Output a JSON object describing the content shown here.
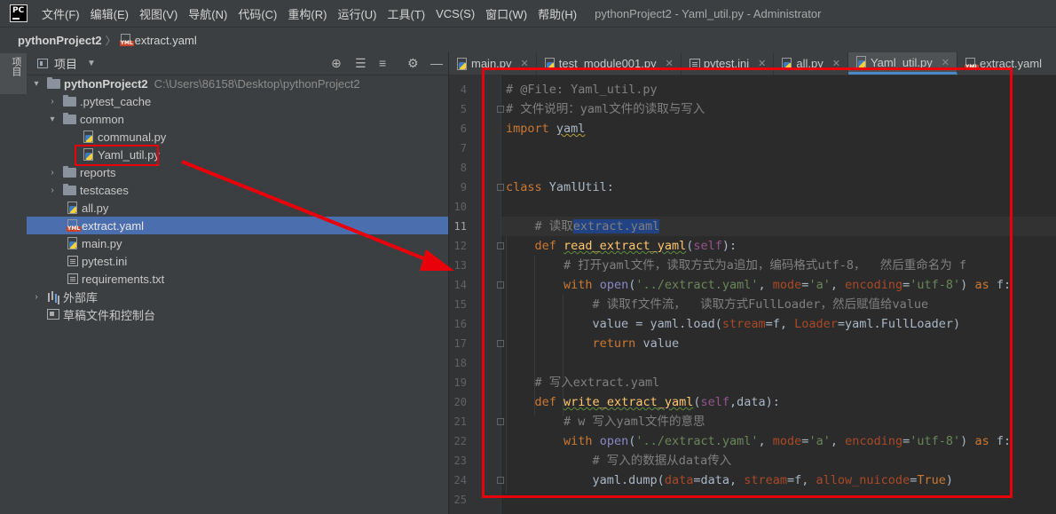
{
  "titlebar": {
    "logo": "PC",
    "menu": [
      "文件(F)",
      "编辑(E)",
      "视图(V)",
      "导航(N)",
      "代码(C)",
      "重构(R)",
      "运行(U)",
      "工具(T)",
      "VCS(S)",
      "窗口(W)",
      "帮助(H)"
    ],
    "window_title": "pythonProject2 - Yaml_util.py - Administrator"
  },
  "breadcrumb": {
    "project": "pythonProject2",
    "file": "extract.yaml"
  },
  "tool_stripe": {
    "project_label": "项目"
  },
  "project_panel": {
    "title": "项目",
    "header_icons": [
      "target-icon",
      "expand-all-icon",
      "collapse-all-icon",
      "gear-icon",
      "minimize-icon"
    ],
    "tree": [
      {
        "label": "pythonProject2",
        "path": "C:\\Users\\86158\\Desktop\\pythonProject2",
        "type": "folder",
        "expanded": true,
        "depth": 0
      },
      {
        "label": ".pytest_cache",
        "type": "folder",
        "expanded": false,
        "depth": 1
      },
      {
        "label": "common",
        "type": "folder",
        "expanded": true,
        "depth": 1
      },
      {
        "label": "communal.py",
        "type": "py",
        "depth": 2
      },
      {
        "label": "Yaml_util.py",
        "type": "py",
        "depth": 2
      },
      {
        "label": "reports",
        "type": "folder",
        "expanded": false,
        "depth": 1
      },
      {
        "label": "testcases",
        "type": "folder",
        "expanded": false,
        "depth": 1
      },
      {
        "label": "all.py",
        "type": "py",
        "depth": 1
      },
      {
        "label": "extract.yaml",
        "type": "yaml",
        "depth": 1,
        "selected": true
      },
      {
        "label": "main.py",
        "type": "py",
        "depth": 1
      },
      {
        "label": "pytest.ini",
        "type": "ini",
        "depth": 1
      },
      {
        "label": "requirements.txt",
        "type": "txt",
        "depth": 1
      },
      {
        "label": "外部库",
        "type": "extlib",
        "expanded": false,
        "depth": 0
      },
      {
        "label": "草稿文件和控制台",
        "type": "scratch",
        "depth": 0
      }
    ]
  },
  "tabs": [
    {
      "label": "main.py",
      "icon": "python-file-icon"
    },
    {
      "label": "test_module001.py",
      "icon": "python-file-icon"
    },
    {
      "label": "pytest.ini",
      "icon": "ini-file-icon"
    },
    {
      "label": "all.py",
      "icon": "python-file-icon"
    },
    {
      "label": "Yaml_util.py",
      "icon": "python-file-icon",
      "active": true
    },
    {
      "label": "extract.yaml",
      "icon": "yaml-file-icon"
    }
  ],
  "editor": {
    "current_line": 11,
    "line_numbers": [
      "4",
      "5",
      "6",
      "7",
      "8",
      "9",
      "10",
      "11",
      "12",
      "13",
      "14",
      "15",
      "16",
      "17",
      "18",
      "19",
      "20",
      "21",
      "22",
      "23",
      "24",
      "25"
    ],
    "lines": [
      {
        "n": "4",
        "text": "# @File: Yaml_util.py"
      },
      {
        "n": "5",
        "text": "# 文件说明：yaml文件的读取与写入"
      },
      {
        "n": "6",
        "text": "import yaml"
      },
      {
        "n": "7",
        "text": ""
      },
      {
        "n": "8",
        "text": ""
      },
      {
        "n": "9",
        "text": "class YamlUtil:"
      },
      {
        "n": "10",
        "text": ""
      },
      {
        "n": "11",
        "text": "    # 读取extract.yaml"
      },
      {
        "n": "12",
        "text": "    def read_extract_yaml(self):"
      },
      {
        "n": "13",
        "text": "        # 打开yaml文件，读取方式为a追加，编码格式utf-8，  然后重命名为 f"
      },
      {
        "n": "14",
        "text": "        with open('../extract.yaml', mode='a', encoding='utf-8') as f:"
      },
      {
        "n": "15",
        "text": "            # 读取f文件流，  读取方式FullLoader，然后赋值给value"
      },
      {
        "n": "16",
        "text": "            value = yaml.load(stream=f, Loader=yaml.FullLoader)"
      },
      {
        "n": "17",
        "text": "            return value"
      },
      {
        "n": "18",
        "text": ""
      },
      {
        "n": "19",
        "text": "    # 写入extract.yaml"
      },
      {
        "n": "20",
        "text": "    def write_extract_yaml(self,data):"
      },
      {
        "n": "21",
        "text": "        # w 写入yaml文件的意思"
      },
      {
        "n": "22",
        "text": "        with open('../extract.yaml', mode='a', encoding='utf-8') as f:"
      },
      {
        "n": "23",
        "text": "            # 写入的数据从data传入"
      },
      {
        "n": "24",
        "text": "            yaml.dump(data=data, stream=f, allow_nuicode=True)"
      },
      {
        "n": "25",
        "text": ""
      }
    ]
  },
  "annotation_color": "#e8000a"
}
